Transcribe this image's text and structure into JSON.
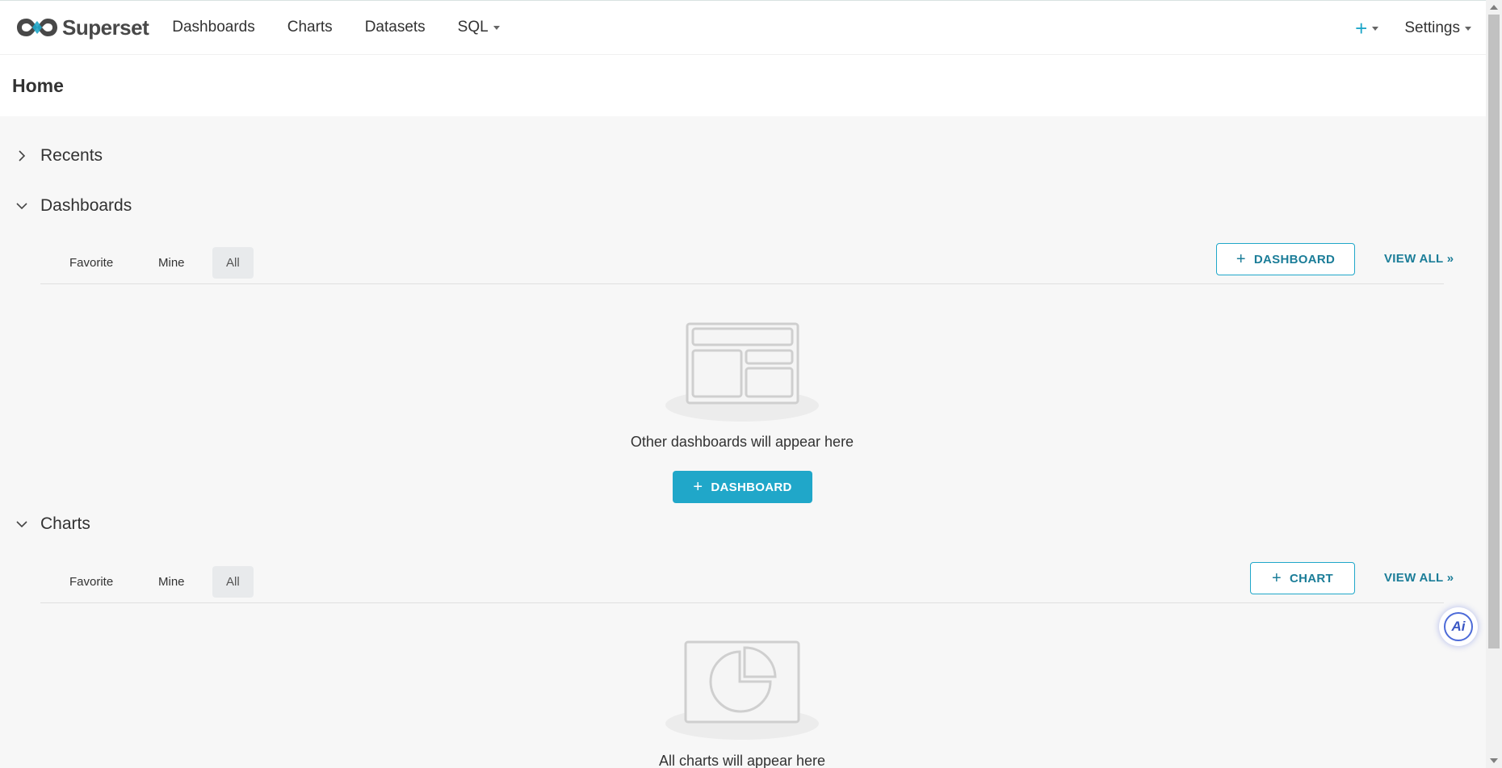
{
  "navbar": {
    "brand": "Superset",
    "links": [
      {
        "label": "Dashboards"
      },
      {
        "label": "Charts"
      },
      {
        "label": "Datasets"
      },
      {
        "label": "SQL"
      }
    ],
    "plus_label": "+",
    "settings_label": "Settings"
  },
  "page": {
    "title": "Home"
  },
  "sections": {
    "recents": {
      "title": "Recents",
      "expanded": false
    },
    "dashboards": {
      "title": "Dashboards",
      "expanded": true,
      "tabs": [
        "Favorite",
        "Mine",
        "All"
      ],
      "active_tab": "All",
      "add_label": "DASHBOARD",
      "view_all_label": "VIEW ALL »",
      "empty_text": "Other dashboards will appear here",
      "empty_button_label": "DASHBOARD"
    },
    "charts": {
      "title": "Charts",
      "expanded": true,
      "tabs": [
        "Favorite",
        "Mine",
        "All"
      ],
      "active_tab": "All",
      "add_label": "CHART",
      "view_all_label": "VIEW ALL »",
      "empty_text": "All charts will appear here"
    }
  },
  "ai_button": {
    "label": "Ai"
  },
  "colors": {
    "accent": "#20a7c9",
    "accent_text": "#1b7d98",
    "background": "#f7f7f7"
  }
}
